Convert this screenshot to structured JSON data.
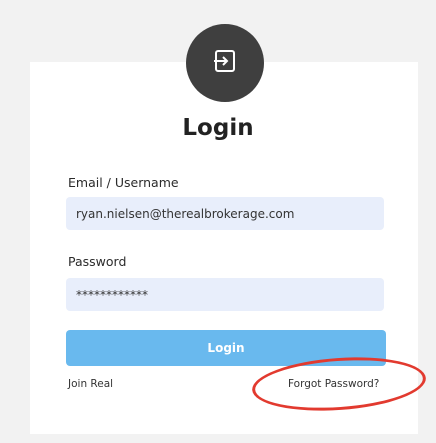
{
  "login": {
    "title": "Login",
    "email_label": "Email / Username",
    "email_value": "ryan.nielsen@therealbrokerage.com",
    "password_label": "Password",
    "password_value": "************",
    "button_label": "Login",
    "join_link": "Join Real",
    "forgot_link": "Forgot Password?"
  },
  "colors": {
    "page_background": "#f2f2f2",
    "avatar_background": "#3f3f3f",
    "input_background": "#e8eefb",
    "button_background": "#69b9ee",
    "annotation_ring": "#e23a2f"
  },
  "icons": {
    "avatar": "login-arrow-icon"
  }
}
